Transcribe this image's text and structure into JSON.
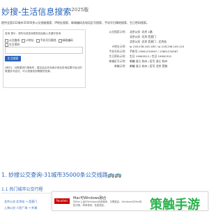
{
  "header": {
    "title": "妙搜-生活信息搜索",
    "version": "2025版"
  },
  "intro": "提供全国332城市35000多公交线路搜索、IP地址搜索、邮政编码及电话区号搜索、手机号归属地搜索、生日密码搜索。",
  "search": {
    "prompt": "查询 提示：请先勾选查询类型然后输入关键字查询",
    "options": [
      "公交路线",
      "IP地址",
      "手机号归属地",
      "邮政编码",
      "生日密码"
    ],
    "button_label": "生活搜索",
    "note": "[常识]：对数据进行搜索时，建议结合本页面示例及查询结果中给出的数据多次尝试，可以快速找到需要的答案。"
  },
  "info": [
    {
      "label": "公交搜索示例：",
      "value": "北京公交 ·北京 1路"
    },
    {
      "label": "",
      "value": "北京公交 ·北京 西直门"
    },
    {
      "label": "",
      "value": "北京公交 ·北京 西直门 - 北京站"
    },
    {
      "label": "IP地址示例：",
      "value": "ip 218.236.100.183 / ip 218.236.100.110"
    },
    {
      "label": "手机号码示例：",
      "value": "手机号 13601234567 / 13601234567"
    },
    {
      "label": "生日密码示例：",
      "value": "生日 19900512 / 生日 19950310"
    },
    {
      "label": "邮编区号示例：",
      "value": "邮编 浙江 杭州 / 区号 浙江 杭州"
    },
    {
      "label": "邮编示例：",
      "value": "邮编 浙江 杭州 / 区号 北京 西城"
    }
  ],
  "section": {
    "title": "1. 妙搜公交查询-31城市35000条公交线路",
    "emoji": "🚌🚌"
  },
  "subsection": "1.1 热门城市公交行程",
  "links": [
    "北京公交·北京站 → 西直门",
    "北京公交·国贸 → 天安门",
    "上海公交·人民广场 → 外滩"
  ],
  "ad": {
    "logo": "Parallels",
    "title": "Mac可Windows融合",
    "desc": "在Mac上运行Windows应用程序，无需重启，Windows与Mac轻松切换，简单易用，性能强劲。",
    "watermark": "策触手游",
    "watermark_sub": "www.cemonarch.com"
  }
}
